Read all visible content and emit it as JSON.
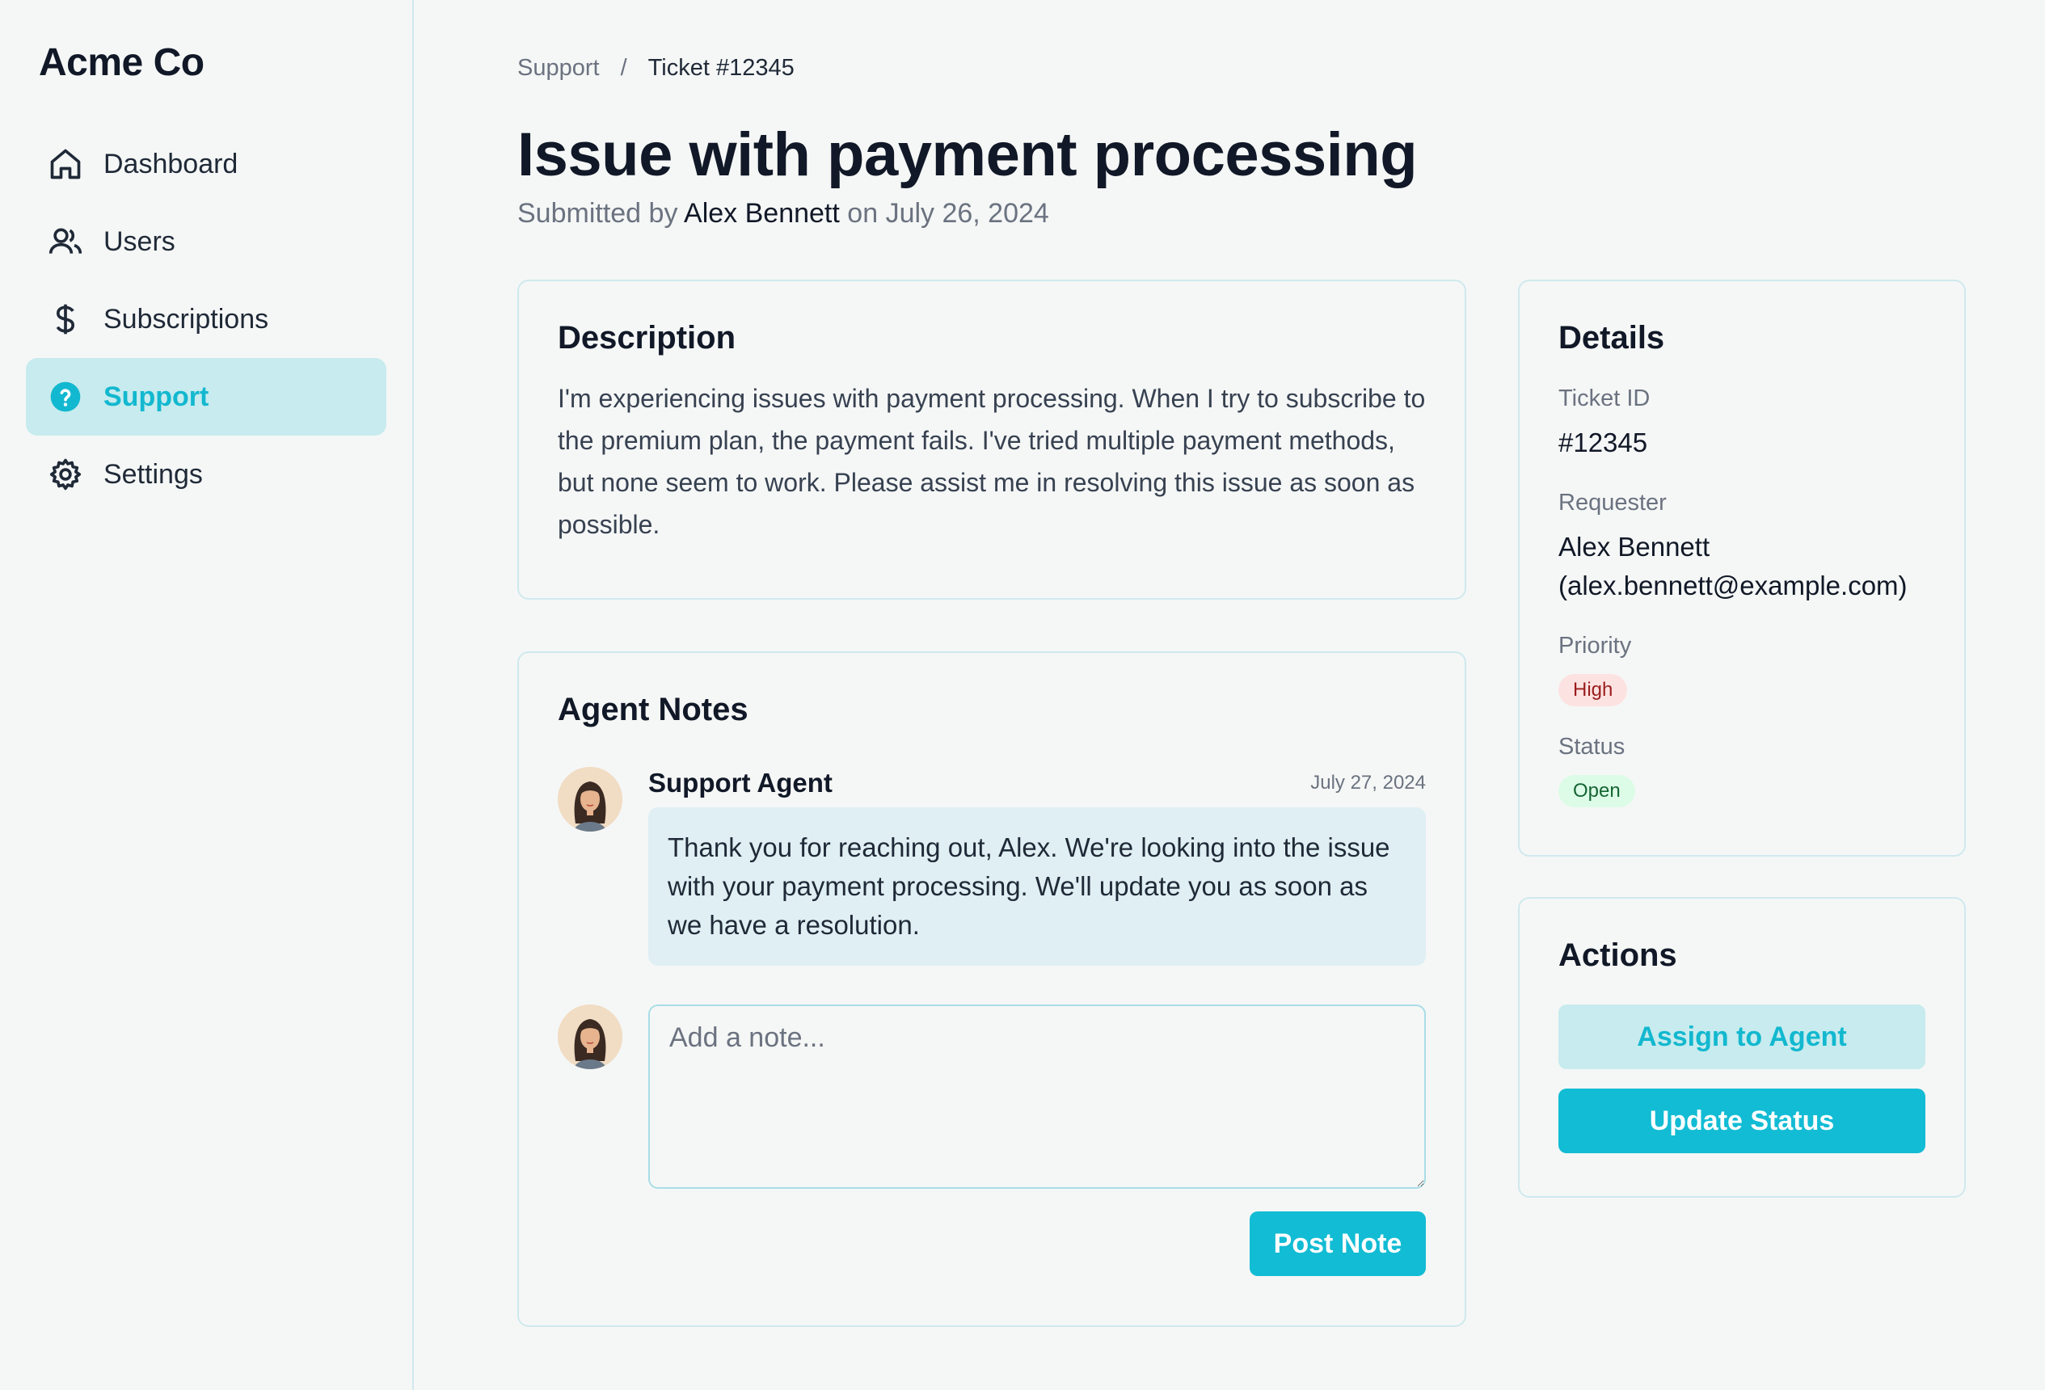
{
  "brand": "Acme Co",
  "sidebar": {
    "items": [
      {
        "label": "Dashboard",
        "icon": "home-icon"
      },
      {
        "label": "Users",
        "icon": "users-icon"
      },
      {
        "label": "Subscriptions",
        "icon": "dollar-icon"
      },
      {
        "label": "Support",
        "icon": "help-circle-icon",
        "active": true
      },
      {
        "label": "Settings",
        "icon": "gear-icon"
      }
    ]
  },
  "breadcrumb": {
    "parent": "Support",
    "separator": "/",
    "current": "Ticket #12345"
  },
  "ticket": {
    "title": "Issue with payment processing",
    "submitted_prefix": "Submitted by",
    "submitted_by": "Alex Bennett",
    "submitted_on_prefix": "on",
    "submitted_date": "July 26, 2024"
  },
  "description": {
    "heading": "Description",
    "text": "I'm experiencing issues with payment processing. When I try to subscribe to the premium plan, the payment fails. I've tried multiple payment methods, but none seem to work. Please assist me in resolving this issue as soon as possible."
  },
  "notes": {
    "heading": "Agent Notes",
    "items": [
      {
        "author": "Support Agent",
        "date": "July 27, 2024",
        "text": "Thank you for reaching out, Alex. We're looking into the issue with your payment processing. We'll update you as soon as we have a resolution."
      }
    ],
    "compose_placeholder": "Add a note...",
    "post_label": "Post Note"
  },
  "details": {
    "heading": "Details",
    "ticket_id_label": "Ticket ID",
    "ticket_id": "#12345",
    "requester_label": "Requester",
    "requester_name": "Alex Bennett",
    "requester_email": "(alex.bennett@example.com)",
    "priority_label": "Priority",
    "priority": "High",
    "status_label": "Status",
    "status": "Open"
  },
  "actions": {
    "heading": "Actions",
    "assign_label": "Assign to Agent",
    "update_label": "Update Status"
  },
  "colors": {
    "accent": "#12bcd4",
    "accent_light": "#c7ebee",
    "border": "#cfe9ee",
    "priority_high_bg": "#fde2e2",
    "status_open_bg": "#dcfce7"
  }
}
